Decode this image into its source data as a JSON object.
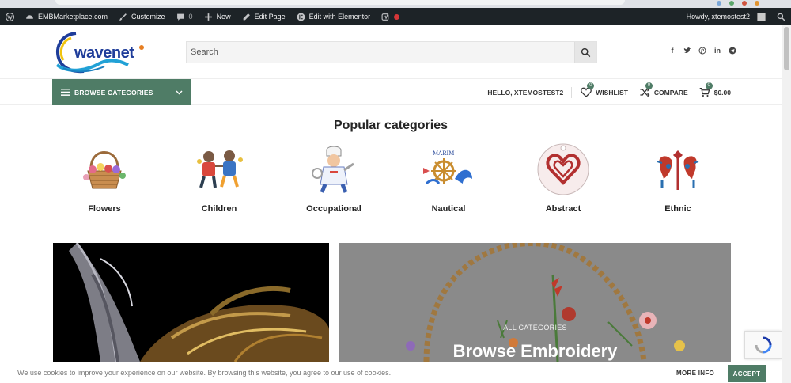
{
  "adminbar": {
    "site_name": "EMBMarketplace.com",
    "customize": "Customize",
    "comments_count": "0",
    "new": "New",
    "edit_page": "Edit Page",
    "edit_elementor": "Edit with Elementor",
    "howdy": "Howdy, xtemostest2",
    "bg_color": "#1d2327"
  },
  "header": {
    "logo_text": "wavenet",
    "search_placeholder": "Search",
    "socials": [
      "facebook-icon",
      "twitter-icon",
      "pinterest-icon",
      "linkedin-icon",
      "telegram-icon"
    ]
  },
  "nav": {
    "browse_label": "BROWSE CATEGORIES",
    "hello": "HELLO, XTEMOSTEST2",
    "wishlist_label": "WISHLIST",
    "wishlist_count": "0",
    "compare_label": "COMPARE",
    "compare_count": "0",
    "cart_count": "0",
    "cart_total": "$0.00",
    "accent_color": "#4f7c66"
  },
  "popular": {
    "title": "Popular categories",
    "categories": [
      {
        "name": "Flowers",
        "icon": "flower-basket-icon"
      },
      {
        "name": "Children",
        "icon": "children-icon"
      },
      {
        "name": "Occupational",
        "icon": "chef-icon"
      },
      {
        "name": "Nautical",
        "icon": "ship-wheel-icon"
      },
      {
        "name": "Abstract",
        "icon": "celtic-heart-icon"
      },
      {
        "name": "Ethnic",
        "icon": "ethnic-birds-icon"
      }
    ]
  },
  "banner": {
    "subtitle": "ALL CATEGORIES",
    "title": "Browse Embroidery"
  },
  "cookie": {
    "text": "We use cookies to improve your experience on our website. By browsing this website, you agree to our use of cookies.",
    "more_info": "MORE INFO",
    "accept": "ACCEPT"
  }
}
